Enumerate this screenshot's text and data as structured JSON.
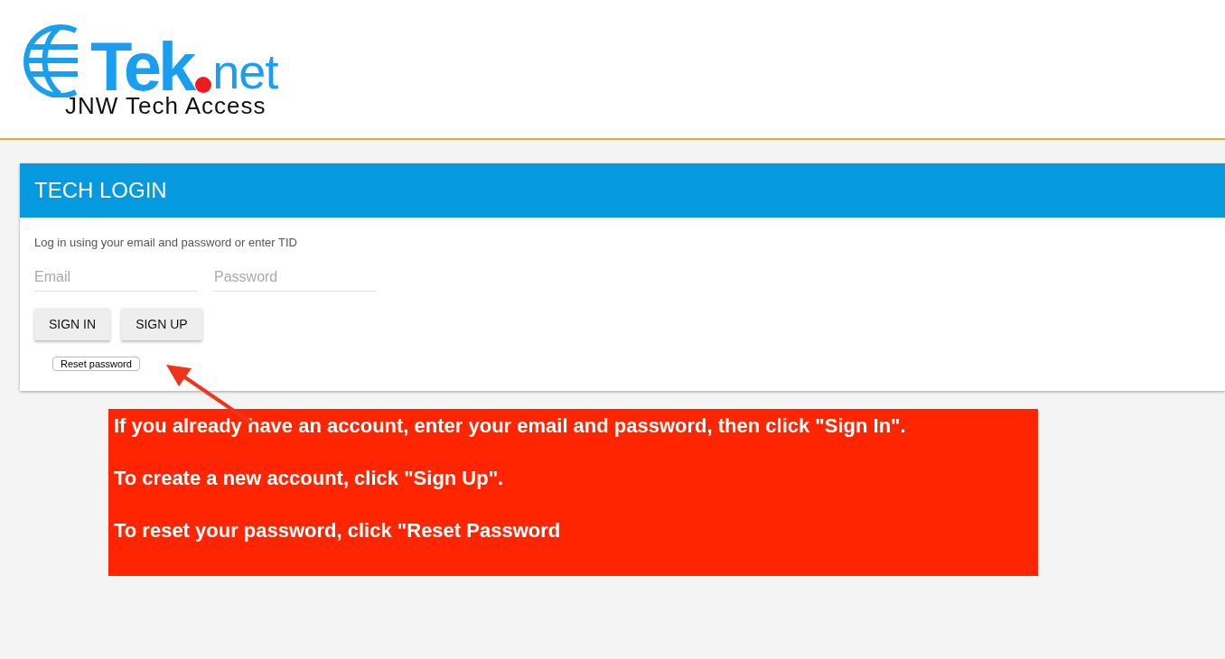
{
  "logo": {
    "brand_start": "Tek",
    "brand_end": "net",
    "tagline": "JNW Tech Access"
  },
  "login_card": {
    "title": "TECH LOGIN",
    "instruction": "Log in using your email and password or enter TID",
    "fields": [
      {
        "placeholder": "Email"
      },
      {
        "placeholder": "Password"
      }
    ],
    "buttons": [
      "SIGN IN",
      "SIGN UP"
    ],
    "reset_button": "Reset password"
  },
  "annotation": {
    "lines": [
      "If you already have an account, enter your email and password, then click \"Sign In\".",
      "To create a new account, click \"Sign Up\".",
      "To reset your password, click \"Reset Password"
    ]
  }
}
